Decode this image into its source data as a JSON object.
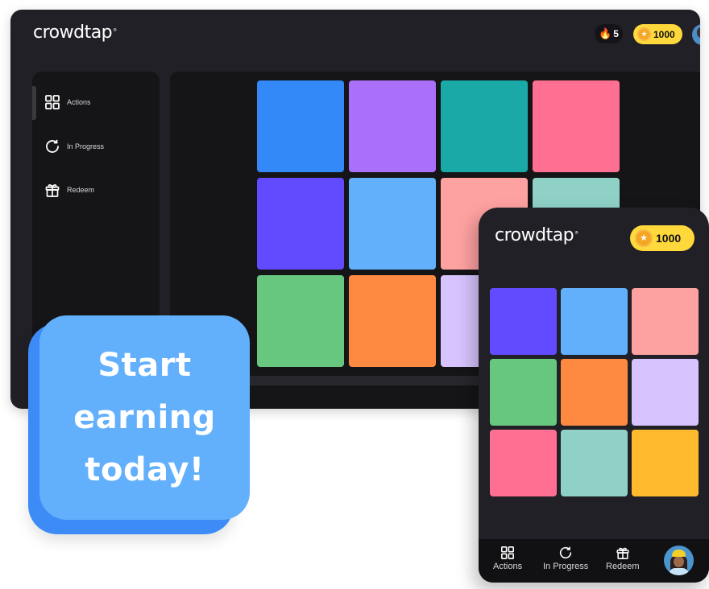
{
  "desktop": {
    "logo": "crowdtap",
    "logo_mark": "®",
    "streak": {
      "icon": "flame-icon",
      "value": "5"
    },
    "points": {
      "icon": "star-coin-icon",
      "value": "1000"
    },
    "sidebar": {
      "items": [
        {
          "label": "Actions",
          "icon": "grid-icon"
        },
        {
          "label": "In Progress",
          "icon": "refresh-icon"
        },
        {
          "label": "Redeem",
          "icon": "gift-icon"
        }
      ]
    },
    "tiles": [
      [
        "#3489f8",
        "#aa6ffb",
        "#1aa9a6",
        "#ff6f91"
      ],
      [
        "#624bfe",
        "#62b0fc",
        "#fea1a1",
        "#8fd1c6"
      ],
      [
        "#68c77f",
        "#fe8a42",
        "#d7c3fe",
        null
      ]
    ]
  },
  "cta": {
    "lines": [
      "Start",
      "earning",
      "today!"
    ]
  },
  "phone": {
    "logo": "crowdtap",
    "logo_mark": "®",
    "points": {
      "icon": "star-coin-icon",
      "value": "1000"
    },
    "tiles": [
      [
        "#624bfe",
        "#62b0fc",
        "#fea1a1"
      ],
      [
        "#68c77f",
        "#fe8a42",
        "#d7c3fe"
      ],
      [
        "#ff6f91",
        "#8fd1c6",
        "#ffbb2d"
      ]
    ],
    "nav": [
      {
        "label": "Actions",
        "icon": "grid-icon"
      },
      {
        "label": "In Progress",
        "icon": "refresh-icon"
      },
      {
        "label": "Redeem",
        "icon": "gift-icon"
      }
    ]
  }
}
